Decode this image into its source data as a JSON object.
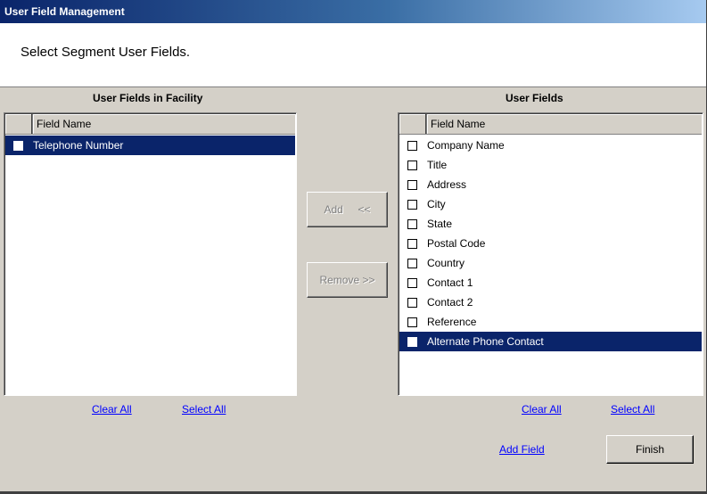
{
  "window": {
    "title": "User Field Management"
  },
  "header": {
    "instruction": "Select Segment User Fields."
  },
  "left_panel": {
    "title": "User Fields in Facility",
    "column_header": "Field Name",
    "rows": [
      {
        "label": "Telephone Number",
        "selected": true,
        "checked": false
      }
    ],
    "clear_all": "Clear All",
    "select_all": "Select All"
  },
  "middle": {
    "add_label": "Add     <<",
    "remove_label": "Remove >>"
  },
  "right_panel": {
    "title": "User Fields",
    "column_header": "Field Name",
    "rows": [
      {
        "label": "Company Name",
        "selected": false,
        "checked": false
      },
      {
        "label": "Title",
        "selected": false,
        "checked": false
      },
      {
        "label": "Address",
        "selected": false,
        "checked": false
      },
      {
        "label": "City",
        "selected": false,
        "checked": false
      },
      {
        "label": "State",
        "selected": false,
        "checked": false
      },
      {
        "label": "Postal Code",
        "selected": false,
        "checked": false
      },
      {
        "label": "Country",
        "selected": false,
        "checked": false
      },
      {
        "label": "Contact 1",
        "selected": false,
        "checked": false
      },
      {
        "label": "Contact 2",
        "selected": false,
        "checked": false
      },
      {
        "label": "Reference",
        "selected": false,
        "checked": false
      },
      {
        "label": "Alternate Phone Contact",
        "selected": true,
        "checked": false
      }
    ],
    "clear_all": "Clear All",
    "select_all": "Select All"
  },
  "footer": {
    "add_field": "Add Field",
    "finish": "Finish"
  },
  "colors": {
    "selection": "#0a246a",
    "dialog_face": "#d4d0c8",
    "link": "#0000ff"
  }
}
